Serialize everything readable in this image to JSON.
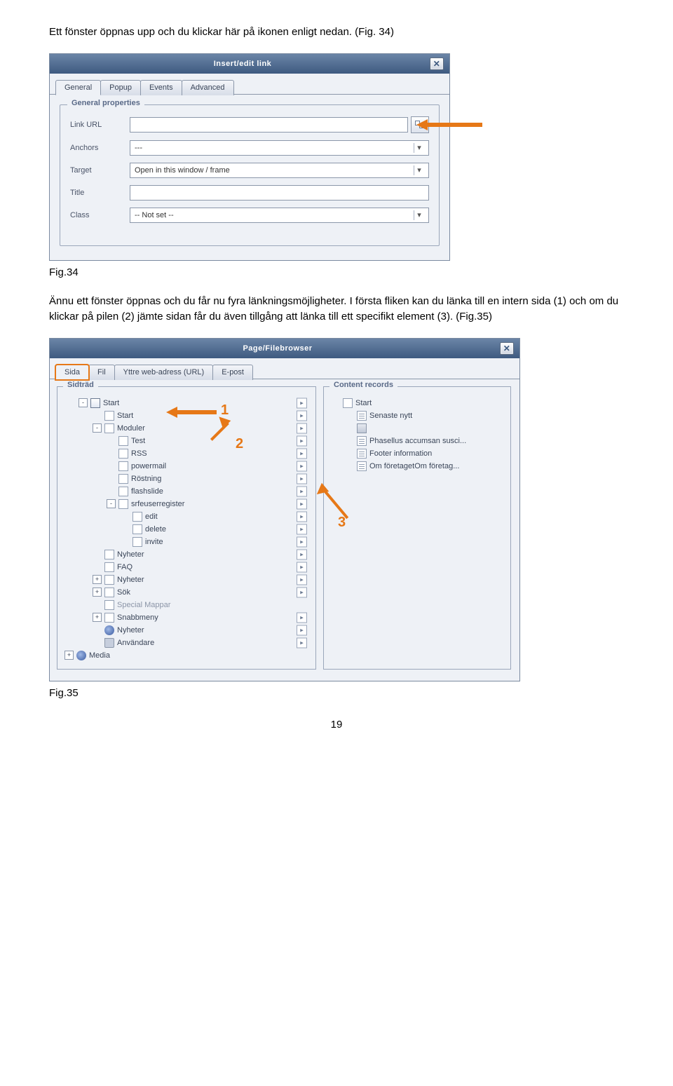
{
  "doc": {
    "intro": "Ett fönster öppnas upp och du klickar här på ikonen enligt nedan. (Fig. 34)",
    "fig34_caption": "Fig.34",
    "between": "Ännu ett fönster öppnas och du får nu fyra länkningsmöjligheter. I första fliken kan du länka till en intern sida (1) och om du klickar på pilen (2) jämte sidan får du även tillgång att länka till ett specifikt element (3). (Fig.35)",
    "fig35_caption": "Fig.35",
    "page_number": "19"
  },
  "dlg1": {
    "title": "Insert/edit link",
    "tabs": [
      "General",
      "Popup",
      "Events",
      "Advanced"
    ],
    "active_tab": 0,
    "fieldset_title": "General properties",
    "fields": {
      "link_url": {
        "label": "Link URL",
        "value": ""
      },
      "anchors": {
        "label": "Anchors",
        "value": "---"
      },
      "target": {
        "label": "Target",
        "value": "Open in this window / frame"
      },
      "title": {
        "label": "Title",
        "value": ""
      },
      "klass": {
        "label": "Class",
        "value": "-- Not set --"
      }
    }
  },
  "dlg2": {
    "title": "Page/Filebrowser",
    "tabs": [
      "Sida",
      "Fil",
      "Yttre web-adress (URL)",
      "E-post"
    ],
    "active_tab": 0,
    "left_title": "Sidträd",
    "right_title": "Content records",
    "tree": [
      {
        "lv": 1,
        "pm": "-",
        "icon": "pagehome",
        "label": "Start",
        "goto": true
      },
      {
        "lv": 2,
        "pm": "",
        "icon": "page",
        "label": "Start",
        "goto": true
      },
      {
        "lv": 2,
        "pm": "-",
        "icon": "page",
        "label": "Moduler",
        "goto": true
      },
      {
        "lv": 3,
        "pm": "",
        "icon": "page",
        "label": "Test",
        "goto": true
      },
      {
        "lv": 3,
        "pm": "",
        "icon": "page",
        "label": "RSS",
        "goto": true
      },
      {
        "lv": 3,
        "pm": "",
        "icon": "page",
        "label": "powermail",
        "goto": true
      },
      {
        "lv": 3,
        "pm": "",
        "icon": "page",
        "label": "Röstning",
        "goto": true
      },
      {
        "lv": 3,
        "pm": "",
        "icon": "page",
        "label": "flashslide",
        "goto": true
      },
      {
        "lv": 3,
        "pm": "-",
        "icon": "page",
        "label": "srfeuserregister",
        "goto": true
      },
      {
        "lv": 4,
        "pm": "",
        "icon": "page",
        "label": "edit",
        "goto": true
      },
      {
        "lv": 4,
        "pm": "",
        "icon": "page",
        "label": "delete",
        "goto": true
      },
      {
        "lv": 4,
        "pm": "",
        "icon": "page",
        "label": "invite",
        "goto": true
      },
      {
        "lv": 2,
        "pm": "",
        "icon": "page",
        "label": "Nyheter",
        "goto": true
      },
      {
        "lv": 2,
        "pm": "",
        "icon": "page",
        "label": "FAQ",
        "goto": true
      },
      {
        "lv": 2,
        "pm": "+",
        "icon": "page",
        "label": "Nyheter",
        "goto": true
      },
      {
        "lv": 2,
        "pm": "+",
        "icon": "page",
        "label": "Sök",
        "goto": true
      },
      {
        "lv": 2,
        "pm": "",
        "icon": "page",
        "label": "Special Mappar",
        "goto": false,
        "dim": true
      },
      {
        "lv": 2,
        "pm": "+",
        "icon": "page",
        "label": "Snabbmeny",
        "goto": true
      },
      {
        "lv": 2,
        "pm": "",
        "icon": "globe",
        "label": "Nyheter",
        "goto": true
      },
      {
        "lv": 2,
        "pm": "",
        "icon": "folder",
        "label": "Användare",
        "goto": true
      },
      {
        "lv": 0,
        "pm": "+",
        "icon": "globe",
        "label": "Media",
        "goto": false
      }
    ],
    "records": [
      {
        "icon": "page",
        "label": "Start"
      },
      {
        "icon": "content",
        "label": "Senaste nytt"
      },
      {
        "icon": "box",
        "label": ""
      },
      {
        "icon": "content",
        "label": "Phasellus accumsan susci..."
      },
      {
        "icon": "content",
        "label": "Footer information"
      },
      {
        "icon": "content",
        "label": "Om företagetOm företag..."
      }
    ],
    "annotations": {
      "n1": "1",
      "n2": "2",
      "n3": "3"
    }
  }
}
